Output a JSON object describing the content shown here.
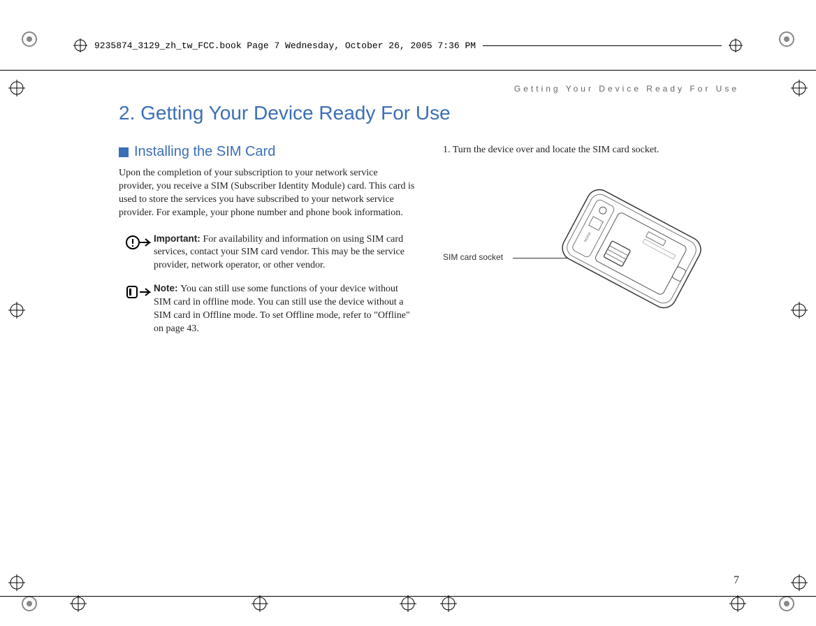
{
  "book_header": "9235874_3129_zh_tw_FCC.book  Page 7  Wednesday, October 26, 2005  7:36 PM",
  "running_head": "Getting Your Device Ready For Use",
  "chapter_title": "2.   Getting Your Device Ready For Use",
  "section_title": "Installing the SIM Card",
  "intro_para": "Upon the completion of your subscription to your network service provider, you receive a SIM (Subscriber Identity Module) card. This card is used to store the services you have subscribed to your network service provider. For example, your phone number and phone book information.",
  "important": {
    "label": "Important: ",
    "text": "For availability and information on using SIM card services, contact your SIM card vendor. This may be the service provider, network operator, or other vendor."
  },
  "note": {
    "label": "Note: ",
    "text": "You can still use some functions of your device without SIM card in offline mode. You can still use the device without a SIM card in Offline mode. To set Offline mode, refer to \"Offline\" on page 43."
  },
  "step1": "1. Turn the device over and locate the SIM card socket.",
  "figure_label": "SIM card socket",
  "page_number": "7"
}
